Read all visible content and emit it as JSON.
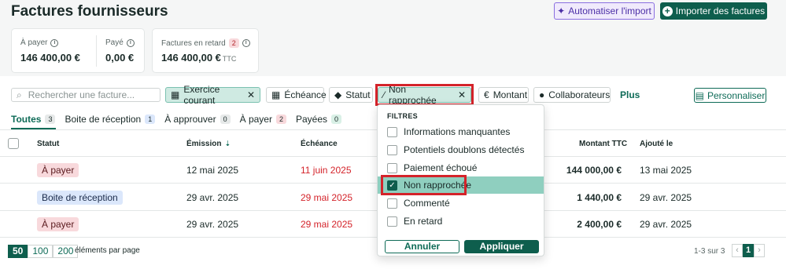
{
  "header": {
    "title": "Factures fournisseurs",
    "automate_label": "Automatiser l'import",
    "import_label": "Importer des factures"
  },
  "kpis": {
    "a_payer_label": "À payer",
    "a_payer_value": "146 400,00 €",
    "paye_label": "Payé",
    "paye_value": "0,00 €",
    "retard_label": "Factures en retard",
    "retard_count": "2",
    "retard_value": "146 400,00 €",
    "retard_suffix": "TTC"
  },
  "filters": {
    "search_placeholder": "Rechercher une facture...",
    "chips": {
      "exercice": "Exercice courant",
      "echeance": "Échéance",
      "statut": "Statut",
      "non_rapprochee": "Non rapprochée",
      "montant": "Montant",
      "collaborateurs": "Collaborateurs"
    },
    "plus_label": "Plus",
    "personnaliser_label": "Personnaliser"
  },
  "tabs": [
    {
      "label": "Toutes",
      "count": "3"
    },
    {
      "label": "Boite de réception",
      "count": "1"
    },
    {
      "label": "À approuver",
      "count": "0"
    },
    {
      "label": "À payer",
      "count": "2"
    },
    {
      "label": "Payées",
      "count": "0"
    }
  ],
  "table": {
    "headers": {
      "statut": "Statut",
      "emission": "Émission",
      "echeance": "Échéance",
      "montant": "Montant TTC",
      "ajoute": "Ajouté le"
    },
    "rows": [
      {
        "statut": "À payer",
        "emission": "12 mai 2025",
        "echeance": "11 juin 2025",
        "montant": "144 000,00 €",
        "ajoute": "13 mai 2025"
      },
      {
        "statut": "Boite de réception",
        "emission": "29 avr. 2025",
        "echeance": "29 mai 2025",
        "montant": "1 440,00 €",
        "ajoute": "29 avr. 2025"
      },
      {
        "statut": "À payer",
        "emission": "29 avr. 2025",
        "echeance": "29 mai 2025",
        "montant": "2 400,00 €",
        "ajoute": "29 avr. 2025"
      }
    ]
  },
  "footer": {
    "page_sizes": [
      "50",
      "100",
      "200"
    ],
    "page_size_label": "éléments par page",
    "range": "1-3 sur 3",
    "prev": "‹",
    "current_page": "1",
    "next": "›"
  },
  "dropdown": {
    "title": "FILTRES",
    "items": [
      {
        "label": "Informations manquantes",
        "checked": false
      },
      {
        "label": "Potentiels doublons détectés",
        "checked": false
      },
      {
        "label": "Paiement échoué",
        "checked": false
      },
      {
        "label": "Non rapprochée",
        "checked": true
      },
      {
        "label": "Commenté",
        "checked": false
      },
      {
        "label": "En retard",
        "checked": false
      }
    ],
    "cancel_label": "Annuler",
    "apply_label": "Appliquer"
  },
  "colors": {
    "brand": "#0e5e4d",
    "danger": "#d4232a",
    "ai_purple": "#4b2fa6"
  }
}
